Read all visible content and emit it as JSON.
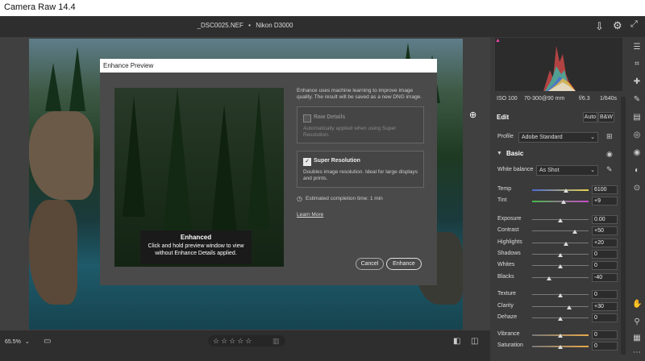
{
  "app": {
    "title": "Camera Raw 14.4"
  },
  "header": {
    "filename": "_DSC0025.NEF",
    "separator": "•",
    "camera": "Nikon D3000"
  },
  "dialog": {
    "title": "Enhance Preview",
    "description": "Enhance uses machine learning to improve image quality. The result will be saved as a new DNG image.",
    "raw_details": {
      "label": "Raw Details",
      "desc": "Automatically applied when using Super Resolution.",
      "checked": false
    },
    "super_resolution": {
      "label": "Super Resolution",
      "desc": "Doubles image resolution. Ideal for large displays and prints.",
      "checked": true
    },
    "estimate": "Estimated completion time: 1 min",
    "learn_more": "Learn More",
    "tooltip_title": "Enhanced",
    "tooltip_body": "Click and hold preview window to view without Enhance Details applied.",
    "cancel": "Cancel",
    "enhance": "Enhance"
  },
  "meta": {
    "iso": "ISO 100",
    "lens": "70-300@90 mm",
    "aperture": "f/6.3",
    "shutter": "1/640s"
  },
  "edit": {
    "title": "Edit",
    "auto": "Auto",
    "bw": "B&W",
    "profile_label": "Profile",
    "profile_value": "Adobe Standard",
    "basic_title": "Basic",
    "wb_label": "White balance",
    "wb_value": "As Shot"
  },
  "sliders": [
    {
      "label": "Temp",
      "value": "6100",
      "pos": 0.6
    },
    {
      "label": "Tint",
      "value": "+9",
      "pos": 0.55
    },
    {
      "label": "Exposure",
      "value": "0.00",
      "pos": 0.5
    },
    {
      "label": "Contrast",
      "value": "+50",
      "pos": 0.75
    },
    {
      "label": "Highlights",
      "value": "+20",
      "pos": 0.6
    },
    {
      "label": "Shadows",
      "value": "0",
      "pos": 0.5
    },
    {
      "label": "Whites",
      "value": "0",
      "pos": 0.5
    },
    {
      "label": "Blacks",
      "value": "-40",
      "pos": 0.3
    },
    {
      "label": "Texture",
      "value": "0",
      "pos": 0.5
    },
    {
      "label": "Clarity",
      "value": "+30",
      "pos": 0.65
    },
    {
      "label": "Dehaze",
      "value": "0",
      "pos": 0.5
    },
    {
      "label": "Vibrance",
      "value": "0",
      "pos": 0.5
    },
    {
      "label": "Saturation",
      "value": "0",
      "pos": 0.5
    }
  ],
  "bottom": {
    "zoom": "65.5%",
    "zoom_arrow": "⌄",
    "stars": "☆☆☆☆☆"
  },
  "colors": {
    "accent": "#e8e8e8",
    "panel": "#3a3a3a"
  }
}
